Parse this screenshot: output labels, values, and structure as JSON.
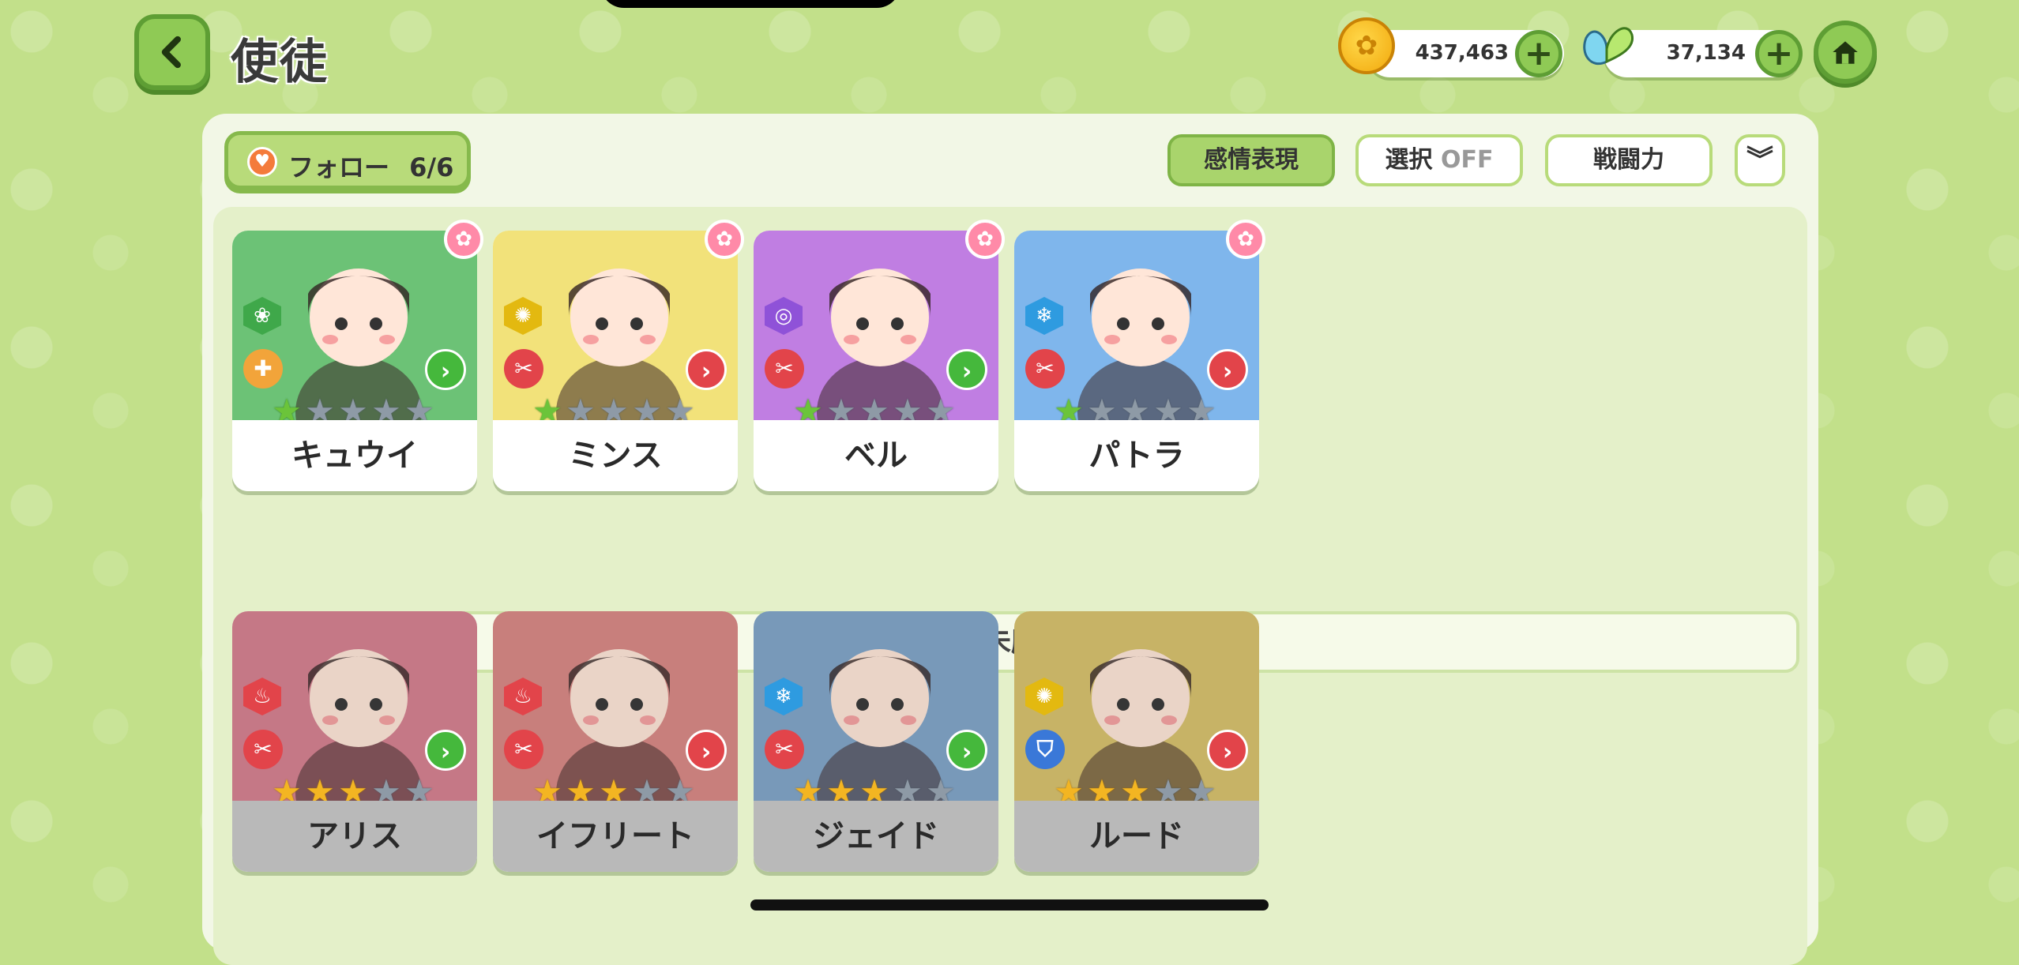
{
  "header": {
    "title": "使徒",
    "coins": "437,463",
    "gems": "37,134"
  },
  "toolbar": {
    "follow_label": "フォロー",
    "follow_count": "6/6",
    "emote_label": "感情表現",
    "select_label": "選択",
    "select_state": "OFF",
    "power_label": "戦闘力",
    "dropdown_icon": "double-chevron-down-icon"
  },
  "owned": [
    {
      "name": "キュウイ",
      "stars": 1,
      "bg": "#6cc276",
      "element": "leaf-icon",
      "element_color": "#3fa84a",
      "role": "cross-icon",
      "role_color": "#f2a43a",
      "arrow_color": "#45b83c"
    },
    {
      "name": "ミンス",
      "stars": 1,
      "bg": "#f2e27a",
      "element": "sun-icon",
      "element_color": "#e3b910",
      "role": "sword-icon",
      "role_color": "#e2444a",
      "arrow_color": "#e2444a"
    },
    {
      "name": "ベル",
      "stars": 1,
      "bg": "#c07ee2",
      "element": "swirl-icon",
      "element_color": "#8f52d8",
      "role": "sword-icon",
      "role_color": "#e2444a",
      "arrow_color": "#45b83c"
    },
    {
      "name": "パトラ",
      "stars": 1,
      "bg": "#7fb6ec",
      "element": "snowflake-icon",
      "element_color": "#2e9be0",
      "role": "sword-icon",
      "role_color": "#e2444a",
      "arrow_color": "#e2444a"
    }
  ],
  "section_unowned": "未所持",
  "unowned": [
    {
      "name": "アリス",
      "stars": 3,
      "bg": "#d57e8e",
      "element": "flame-icon",
      "element_color": "#e2444a",
      "role": "sword-icon",
      "role_color": "#e2444a",
      "arrow_color": "#45b83c"
    },
    {
      "name": "イフリート",
      "stars": 3,
      "bg": "#d98682",
      "element": "flame-icon",
      "element_color": "#e2444a",
      "role": "sword-icon",
      "role_color": "#e2444a",
      "arrow_color": "#e2444a"
    },
    {
      "name": "ジェイド",
      "stars": 3,
      "bg": "#7ea3c8",
      "element": "snowflake-icon",
      "element_color": "#2e9be0",
      "role": "sword-icon",
      "role_color": "#e2444a",
      "arrow_color": "#45b83c"
    },
    {
      "name": "ルード",
      "stars": 3,
      "bg": "#d8c169",
      "element": "sun-icon",
      "element_color": "#e3b910",
      "role": "shield-icon",
      "role_color": "#3a78d8",
      "arrow_color": "#e2444a"
    }
  ]
}
